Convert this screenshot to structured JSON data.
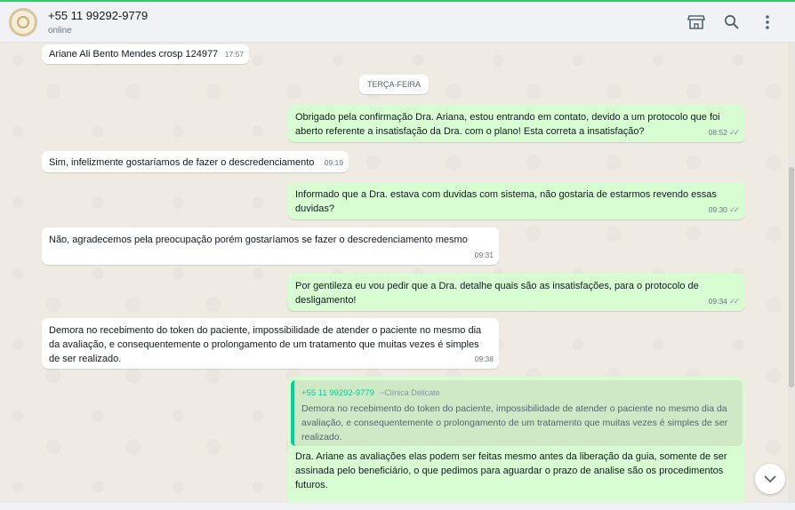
{
  "header": {
    "contact_name": "+55 11 99292-9779",
    "status": "online",
    "icons": [
      "shop-icon",
      "search-icon",
      "menu-dots-icon"
    ]
  },
  "day_separator": "TERÇA-FEIRA",
  "messages": [
    {
      "dir": "in",
      "text": "Ariane Ali Bento Mendes crosp 124977",
      "time": "17:57"
    },
    {
      "dir": "out",
      "text": "Obrigado pela confirmação Dra. Ariana, estou entrando em contato, devido a um protocolo que foi aberto referente a insatisfação da Dra. com o plano! Esta correta a insatisfação?",
      "time": "08:52"
    },
    {
      "dir": "in",
      "text": "Sim, infelizmente gostaríamos de fazer o descredenciamento",
      "time": "09:19"
    },
    {
      "dir": "out",
      "text": "Informado que a Dra. estava com duvidas com sistema, não gostaria de estarmos revendo essas duvidas?",
      "time": "09:30"
    },
    {
      "dir": "in",
      "text": "Não, agradecemos pela preocupação porém gostaríamos se fazer o descredenciamento mesmo",
      "time": "09:31"
    },
    {
      "dir": "out",
      "text": "Por gentileza eu vou pedir que a Dra. detalhe quais são as insatisfações, para o protocolo de desligamento!",
      "time": "09:34"
    },
    {
      "dir": "in",
      "text": "Demora no recebimento do token do paciente, impossibilidade de atender o paciente no mesmo dia da avaliação, e consequentemente o prolongamento de um tratamento que muitas vezes é simples de ser realizado.",
      "time": "09:38"
    }
  ],
  "reply": {
    "quote_author": "+55 11 99292-9779",
    "quote_org": "~Clínica Delicate",
    "quote_text": "Demora no recebimento do token do paciente, impossibilidade de atender o paciente no mesmo dia da avaliação, e consequentemente o prolongamento de um tratamento que muitas vezes é simples de ser realizado.",
    "text": "Dra. Ariane as avaliações elas podem ser feitas mesmo antes da liberação da guia, somente de ser assinada pelo beneficiário, o que pedimos para aguardar o prazo de analise são os procedimentos futuros."
  },
  "colors": {
    "accent": "#25d366",
    "outgoing": "#d9fdd3",
    "incoming": "#ffffff",
    "quote_bar": "#06cf9c"
  }
}
